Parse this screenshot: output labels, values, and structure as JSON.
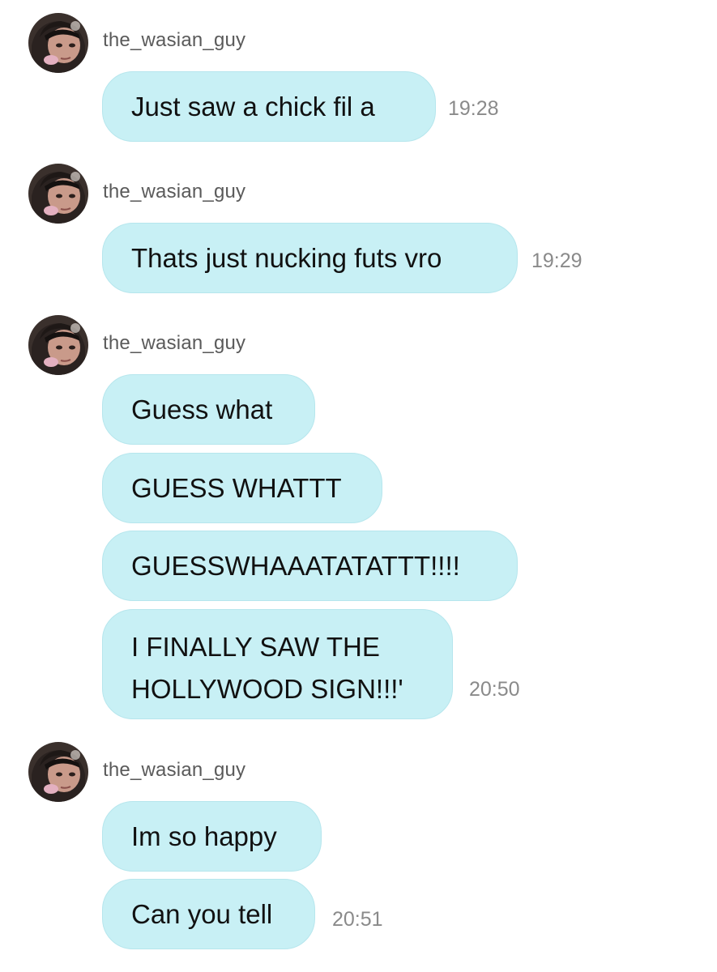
{
  "chat": {
    "groups": [
      {
        "username": "the_wasian_guy",
        "messages": [
          {
            "text": "Just saw a chick fil a",
            "time": "19:28"
          }
        ]
      },
      {
        "username": "the_wasian_guy",
        "messages": [
          {
            "text": "Thats just nucking futs vro",
            "time": "19:29"
          }
        ]
      },
      {
        "username": "the_wasian_guy",
        "messages": [
          {
            "text": "Guess what"
          },
          {
            "text": "GUESS WHATTT"
          },
          {
            "text": "GUESSWHAAATATATTT!!!!"
          },
          {
            "line1": "I FINALLY SAW THE",
            "line2": "HOLLYWOOD SIGN!!!'",
            "time": "20:50"
          }
        ]
      },
      {
        "username": "the_wasian_guy",
        "messages": [
          {
            "text": "Im so happy"
          },
          {
            "text": "Can you tell",
            "time": "20:51"
          }
        ]
      }
    ]
  },
  "colors": {
    "bubble": "#c8f0f5",
    "username": "#5a5a5a",
    "timestamp": "#8a8a8a"
  },
  "icons": {
    "avatar": "profile-avatar-photo"
  }
}
